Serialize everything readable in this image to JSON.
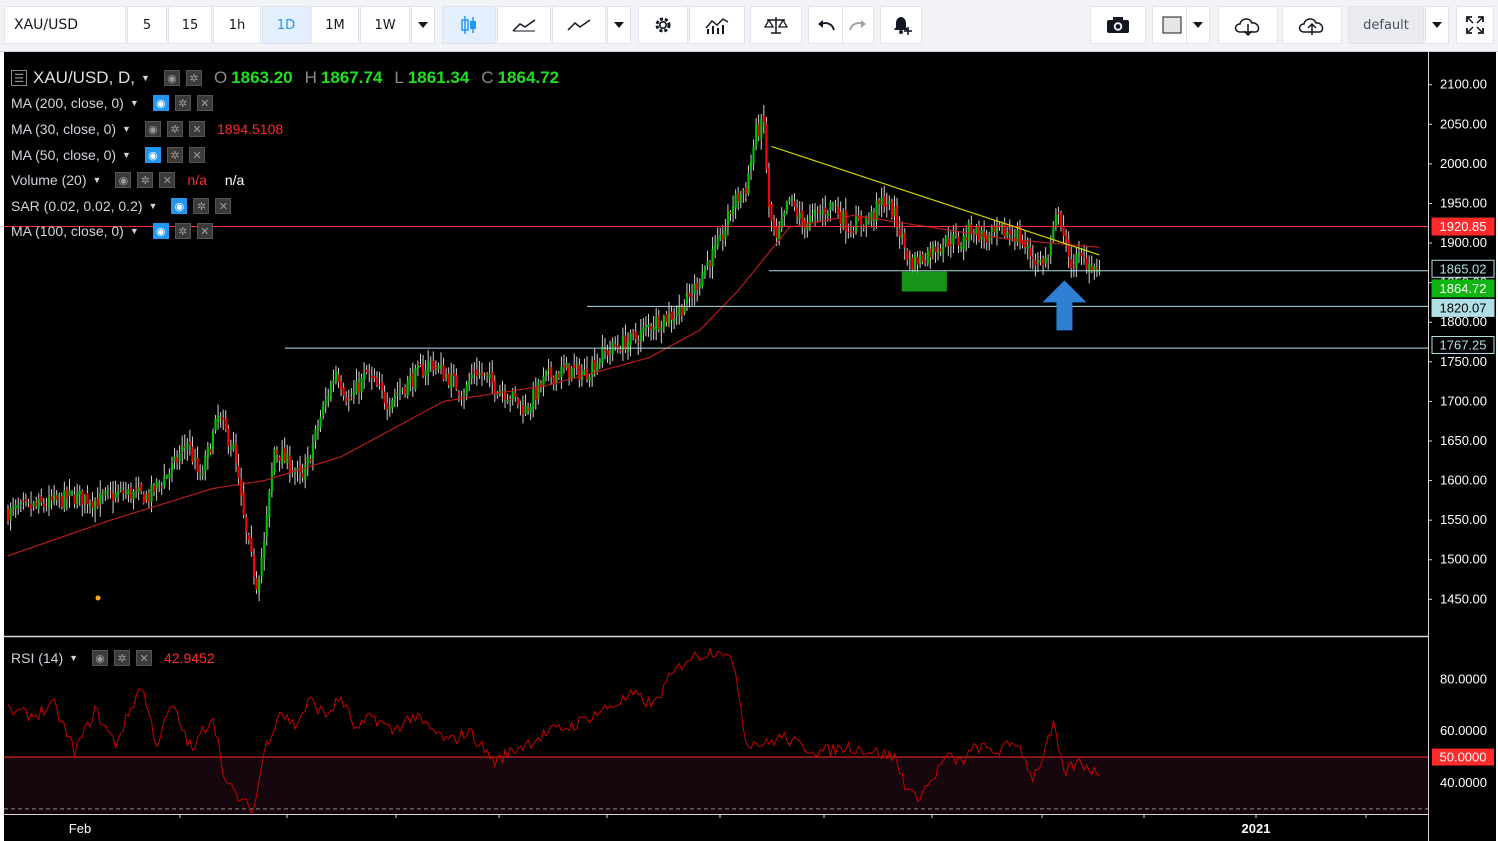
{
  "toolbar": {
    "symbol": "XAU/USD",
    "intervals": [
      "5",
      "15",
      "1h",
      "1D",
      "1M",
      "1W"
    ],
    "active_interval": "1D",
    "preset_label": "default",
    "icons": [
      "dropdown-caret-icon",
      "candles-icon",
      "line-chart-icon",
      "area-chart-icon",
      "dropdown-caret-icon",
      "settings-gear-icon",
      "indicators-icon",
      "compare-scale-icon",
      "undo-icon",
      "redo-icon",
      "alert-icon",
      "camera-icon",
      "color-swatch-icon",
      "dropdown-caret-icon",
      "cloud-download-icon",
      "cloud-upload-icon",
      "dropdown-caret-icon",
      "fullscreen-icon"
    ]
  },
  "legend": {
    "title": "XAU/USD, D,",
    "ohlc": {
      "o_label": "O",
      "o": "1863.20",
      "h_label": "H",
      "h": "1867.74",
      "l_label": "L",
      "l": "1861.34",
      "c_label": "C",
      "c": "1864.72"
    },
    "studies": [
      {
        "name": "MA (200, close, 0)",
        "value": ""
      },
      {
        "name": "MA (30, close, 0)",
        "value": "1894.5108"
      },
      {
        "name": "MA (50, close, 0)",
        "value": ""
      },
      {
        "name": "Volume (20)",
        "value": "n/a",
        "value2": "n/a"
      },
      {
        "name": "SAR (0.02, 0.02, 0.2)",
        "value": ""
      },
      {
        "name": "MA (100, close, 0)",
        "value": ""
      }
    ],
    "rsi": {
      "name": "RSI (14)",
      "value": "42.9452"
    }
  },
  "colors": {
    "up": "#00c200",
    "down": "#ff0000",
    "ma30": "#b71c1c",
    "resistance": "#ff2a2a",
    "support": "#b2dfe6",
    "trendline": "#d4d400",
    "rsi_line": "#cc0000",
    "arrow": "#2f7fd5",
    "last_price_bg": "#11b511"
  },
  "chart_data": [
    {
      "type": "candlestick",
      "title": "XAU/USD, D",
      "ylim": [
        1410,
        2135
      ],
      "y_ticks": [
        "2100.00",
        "2050.00",
        "2000.00",
        "1950.00",
        "1900.00",
        "1850.00",
        "1800.00",
        "1750.00",
        "1700.00",
        "1650.00",
        "1600.00",
        "1550.00",
        "1500.00",
        "1450.00"
      ],
      "x_labels": [
        "Feb",
        "2021"
      ],
      "close_anchors": [
        [
          0,
          1560
        ],
        [
          15,
          1570
        ],
        [
          25,
          1580
        ],
        [
          35,
          1575
        ],
        [
          45,
          1585
        ],
        [
          55,
          1580
        ],
        [
          65,
          1620
        ],
        [
          70,
          1650
        ],
        [
          75,
          1600
        ],
        [
          82,
          1680
        ],
        [
          88,
          1640
        ],
        [
          93,
          1530
        ],
        [
          97,
          1470
        ],
        [
          100,
          1520
        ],
        [
          104,
          1640
        ],
        [
          110,
          1620
        ],
        [
          115,
          1600
        ],
        [
          122,
          1680
        ],
        [
          128,
          1740
        ],
        [
          133,
          1700
        ],
        [
          140,
          1735
        ],
        [
          148,
          1700
        ],
        [
          155,
          1720
        ],
        [
          165,
          1750
        ],
        [
          172,
          1730
        ],
        [
          178,
          1710
        ],
        [
          182,
          1740
        ],
        [
          188,
          1725
        ],
        [
          195,
          1710
        ],
        [
          202,
          1690
        ],
        [
          210,
          1730
        ],
        [
          218,
          1740
        ],
        [
          225,
          1735
        ],
        [
          232,
          1760
        ],
        [
          238,
          1770
        ],
        [
          245,
          1780
        ],
        [
          252,
          1800
        ],
        [
          260,
          1810
        ],
        [
          266,
          1830
        ],
        [
          272,
          1870
        ],
        [
          278,
          1900
        ],
        [
          283,
          1950
        ],
        [
          288,
          1970
        ],
        [
          292,
          2040
        ],
        [
          295,
          2050
        ],
        [
          297,
          1940
        ],
        [
          300,
          1900
        ],
        [
          305,
          1955
        ],
        [
          310,
          1925
        ],
        [
          316,
          1935
        ],
        [
          322,
          1950
        ],
        [
          328,
          1920
        ],
        [
          336,
          1930
        ],
        [
          342,
          1955
        ],
        [
          346,
          1935
        ],
        [
          352,
          1875
        ],
        [
          356,
          1880
        ],
        [
          362,
          1895
        ],
        [
          368,
          1905
        ],
        [
          372,
          1900
        ],
        [
          376,
          1920
        ],
        [
          382,
          1905
        ],
        [
          388,
          1915
        ],
        [
          394,
          1910
        ],
        [
          398,
          1890
        ],
        [
          402,
          1875
        ],
        [
          406,
          1880
        ],
        [
          410,
          1945
        ],
        [
          414,
          1875
        ],
        [
          418,
          1880
        ],
        [
          422,
          1875
        ],
        [
          426,
          1864.72
        ]
      ],
      "ma30_anchors": [
        [
          0,
          1505
        ],
        [
          40,
          1550
        ],
        [
          80,
          1590
        ],
        [
          100,
          1600
        ],
        [
          130,
          1630
        ],
        [
          170,
          1700
        ],
        [
          210,
          1720
        ],
        [
          250,
          1755
        ],
        [
          270,
          1790
        ],
        [
          285,
          1840
        ],
        [
          295,
          1880
        ],
        [
          305,
          1920
        ],
        [
          330,
          1935
        ],
        [
          360,
          1920
        ],
        [
          390,
          1905
        ],
        [
          426,
          1894.51
        ]
      ],
      "horizontal_levels": [
        {
          "price": "1920.85",
          "label": "1920.85",
          "style": "resistance"
        },
        {
          "price": "1865.02",
          "label": "1865.02",
          "style": "support"
        },
        {
          "price": "1820.07",
          "label": "1820.07",
          "style": "support"
        },
        {
          "price": "1767.25",
          "label": "1767.25",
          "style": "support"
        }
      ],
      "last_price": "1864.72",
      "trendline": {
        "from": [
          298,
          2022
        ],
        "to": [
          426,
          1885
        ]
      },
      "bars": 427
    },
    {
      "type": "line",
      "title": "RSI (14)",
      "ylim": [
        28,
        96
      ],
      "y_ticks": [
        "80.0000",
        "60.0000",
        "50.0000",
        "40.0000"
      ],
      "level": 50,
      "last": 42.9452,
      "anchors": [
        [
          0,
          68
        ],
        [
          10,
          66
        ],
        [
          18,
          70
        ],
        [
          26,
          52
        ],
        [
          34,
          68
        ],
        [
          42,
          55
        ],
        [
          52,
          78
        ],
        [
          58,
          55
        ],
        [
          64,
          70
        ],
        [
          72,
          52
        ],
        [
          76,
          60
        ],
        [
          80,
          66
        ],
        [
          85,
          40
        ],
        [
          92,
          32
        ],
        [
          96,
          30
        ],
        [
          100,
          52
        ],
        [
          106,
          68
        ],
        [
          112,
          62
        ],
        [
          118,
          72
        ],
        [
          124,
          66
        ],
        [
          130,
          73
        ],
        [
          136,
          60
        ],
        [
          142,
          66
        ],
        [
          150,
          60
        ],
        [
          158,
          66
        ],
        [
          166,
          60
        ],
        [
          172,
          56
        ],
        [
          180,
          60
        ],
        [
          190,
          48
        ],
        [
          196,
          52
        ],
        [
          204,
          56
        ],
        [
          212,
          60
        ],
        [
          220,
          62
        ],
        [
          228,
          66
        ],
        [
          236,
          70
        ],
        [
          244,
          74
        ],
        [
          252,
          70
        ],
        [
          258,
          80
        ],
        [
          265,
          88
        ],
        [
          272,
          90
        ],
        [
          278,
          92
        ],
        [
          284,
          84
        ],
        [
          288,
          56
        ],
        [
          296,
          55
        ],
        [
          302,
          58
        ],
        [
          310,
          54
        ],
        [
          318,
          52
        ],
        [
          328,
          54
        ],
        [
          338,
          52
        ],
        [
          346,
          50
        ],
        [
          350,
          40
        ],
        [
          354,
          34
        ],
        [
          360,
          40
        ],
        [
          366,
          50
        ],
        [
          372,
          48
        ],
        [
          378,
          54
        ],
        [
          386,
          52
        ],
        [
          394,
          56
        ],
        [
          400,
          42
        ],
        [
          404,
          50
        ],
        [
          408,
          62
        ],
        [
          412,
          44
        ],
        [
          418,
          48
        ],
        [
          422,
          46
        ],
        [
          426,
          42.95
        ]
      ]
    }
  ]
}
